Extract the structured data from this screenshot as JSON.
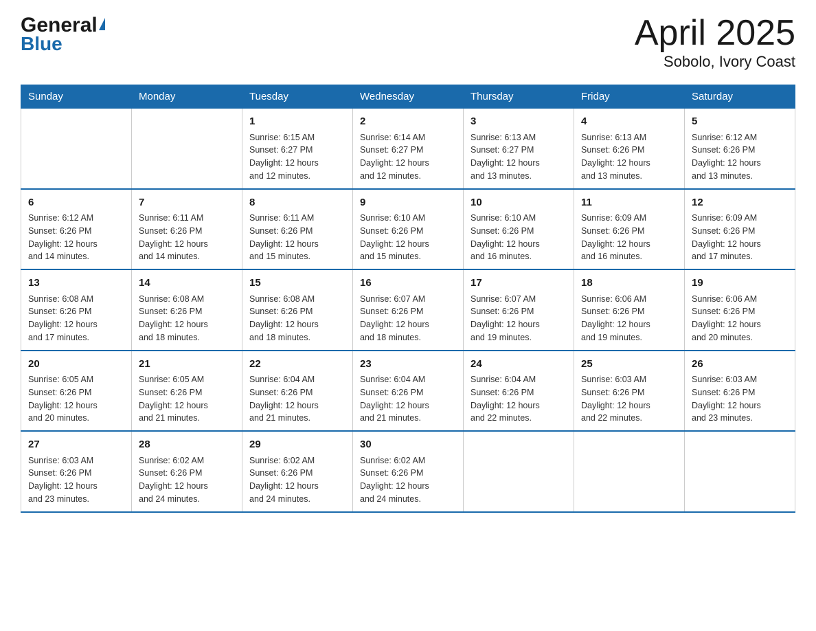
{
  "header": {
    "logo_general": "General",
    "logo_blue": "Blue",
    "title": "April 2025",
    "subtitle": "Sobolo, Ivory Coast"
  },
  "days_of_week": [
    "Sunday",
    "Monday",
    "Tuesday",
    "Wednesday",
    "Thursday",
    "Friday",
    "Saturday"
  ],
  "weeks": [
    [
      {
        "num": "",
        "info": ""
      },
      {
        "num": "",
        "info": ""
      },
      {
        "num": "1",
        "info": "Sunrise: 6:15 AM\nSunset: 6:27 PM\nDaylight: 12 hours\nand 12 minutes."
      },
      {
        "num": "2",
        "info": "Sunrise: 6:14 AM\nSunset: 6:27 PM\nDaylight: 12 hours\nand 12 minutes."
      },
      {
        "num": "3",
        "info": "Sunrise: 6:13 AM\nSunset: 6:27 PM\nDaylight: 12 hours\nand 13 minutes."
      },
      {
        "num": "4",
        "info": "Sunrise: 6:13 AM\nSunset: 6:26 PM\nDaylight: 12 hours\nand 13 minutes."
      },
      {
        "num": "5",
        "info": "Sunrise: 6:12 AM\nSunset: 6:26 PM\nDaylight: 12 hours\nand 13 minutes."
      }
    ],
    [
      {
        "num": "6",
        "info": "Sunrise: 6:12 AM\nSunset: 6:26 PM\nDaylight: 12 hours\nand 14 minutes."
      },
      {
        "num": "7",
        "info": "Sunrise: 6:11 AM\nSunset: 6:26 PM\nDaylight: 12 hours\nand 14 minutes."
      },
      {
        "num": "8",
        "info": "Sunrise: 6:11 AM\nSunset: 6:26 PM\nDaylight: 12 hours\nand 15 minutes."
      },
      {
        "num": "9",
        "info": "Sunrise: 6:10 AM\nSunset: 6:26 PM\nDaylight: 12 hours\nand 15 minutes."
      },
      {
        "num": "10",
        "info": "Sunrise: 6:10 AM\nSunset: 6:26 PM\nDaylight: 12 hours\nand 16 minutes."
      },
      {
        "num": "11",
        "info": "Sunrise: 6:09 AM\nSunset: 6:26 PM\nDaylight: 12 hours\nand 16 minutes."
      },
      {
        "num": "12",
        "info": "Sunrise: 6:09 AM\nSunset: 6:26 PM\nDaylight: 12 hours\nand 17 minutes."
      }
    ],
    [
      {
        "num": "13",
        "info": "Sunrise: 6:08 AM\nSunset: 6:26 PM\nDaylight: 12 hours\nand 17 minutes."
      },
      {
        "num": "14",
        "info": "Sunrise: 6:08 AM\nSunset: 6:26 PM\nDaylight: 12 hours\nand 18 minutes."
      },
      {
        "num": "15",
        "info": "Sunrise: 6:08 AM\nSunset: 6:26 PM\nDaylight: 12 hours\nand 18 minutes."
      },
      {
        "num": "16",
        "info": "Sunrise: 6:07 AM\nSunset: 6:26 PM\nDaylight: 12 hours\nand 18 minutes."
      },
      {
        "num": "17",
        "info": "Sunrise: 6:07 AM\nSunset: 6:26 PM\nDaylight: 12 hours\nand 19 minutes."
      },
      {
        "num": "18",
        "info": "Sunrise: 6:06 AM\nSunset: 6:26 PM\nDaylight: 12 hours\nand 19 minutes."
      },
      {
        "num": "19",
        "info": "Sunrise: 6:06 AM\nSunset: 6:26 PM\nDaylight: 12 hours\nand 20 minutes."
      }
    ],
    [
      {
        "num": "20",
        "info": "Sunrise: 6:05 AM\nSunset: 6:26 PM\nDaylight: 12 hours\nand 20 minutes."
      },
      {
        "num": "21",
        "info": "Sunrise: 6:05 AM\nSunset: 6:26 PM\nDaylight: 12 hours\nand 21 minutes."
      },
      {
        "num": "22",
        "info": "Sunrise: 6:04 AM\nSunset: 6:26 PM\nDaylight: 12 hours\nand 21 minutes."
      },
      {
        "num": "23",
        "info": "Sunrise: 6:04 AM\nSunset: 6:26 PM\nDaylight: 12 hours\nand 21 minutes."
      },
      {
        "num": "24",
        "info": "Sunrise: 6:04 AM\nSunset: 6:26 PM\nDaylight: 12 hours\nand 22 minutes."
      },
      {
        "num": "25",
        "info": "Sunrise: 6:03 AM\nSunset: 6:26 PM\nDaylight: 12 hours\nand 22 minutes."
      },
      {
        "num": "26",
        "info": "Sunrise: 6:03 AM\nSunset: 6:26 PM\nDaylight: 12 hours\nand 23 minutes."
      }
    ],
    [
      {
        "num": "27",
        "info": "Sunrise: 6:03 AM\nSunset: 6:26 PM\nDaylight: 12 hours\nand 23 minutes."
      },
      {
        "num": "28",
        "info": "Sunrise: 6:02 AM\nSunset: 6:26 PM\nDaylight: 12 hours\nand 24 minutes."
      },
      {
        "num": "29",
        "info": "Sunrise: 6:02 AM\nSunset: 6:26 PM\nDaylight: 12 hours\nand 24 minutes."
      },
      {
        "num": "30",
        "info": "Sunrise: 6:02 AM\nSunset: 6:26 PM\nDaylight: 12 hours\nand 24 minutes."
      },
      {
        "num": "",
        "info": ""
      },
      {
        "num": "",
        "info": ""
      },
      {
        "num": "",
        "info": ""
      }
    ]
  ]
}
